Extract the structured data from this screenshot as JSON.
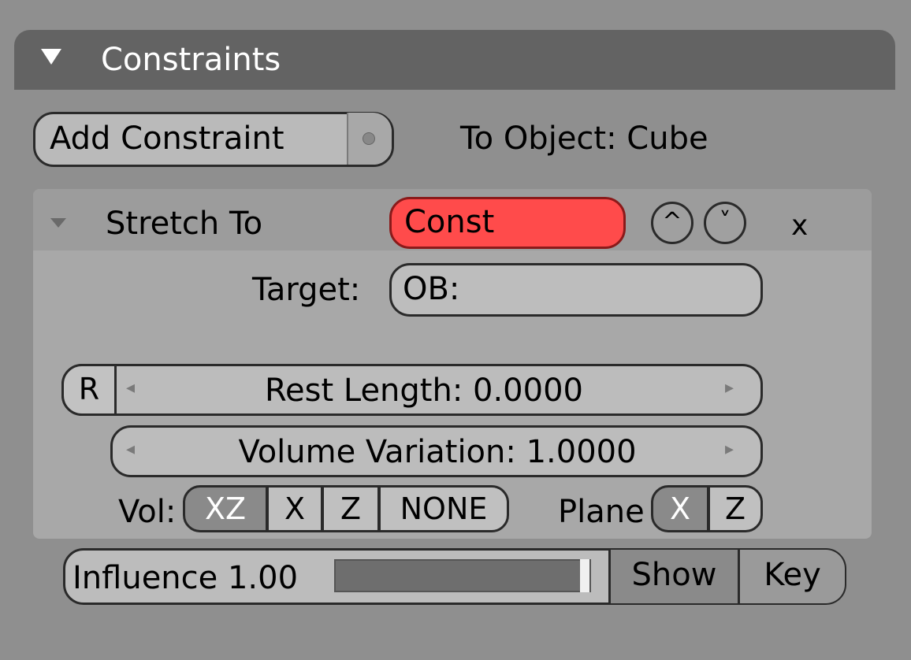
{
  "panel": {
    "title": "Constraints",
    "add_constraint_label": "Add Constraint",
    "to_object_label": "To Object: Cube"
  },
  "constraint": {
    "type_label": "Stretch To",
    "name_value": "Const",
    "name_color": "#ff4b4b",
    "move_up_icon": "chevron-up-icon",
    "move_down_icon": "chevron-down-icon",
    "delete_label": "x",
    "target_label": "Target:",
    "target_value": "OB:",
    "r_button_label": "R",
    "rest_length_label": "Rest Length: 0.0000",
    "volume_variation_label": "Volume Variation: 1.0000",
    "vol_label": "Vol:",
    "vol_options": [
      "XZ",
      "X",
      "Z",
      "NONE"
    ],
    "vol_selected": "XZ",
    "plane_label": "Plane",
    "plane_options": [
      "X",
      "Z"
    ],
    "plane_selected": "X"
  },
  "influence": {
    "label": "Influence 1.00",
    "value": 1.0,
    "show_label": "Show",
    "key_label": "Key"
  }
}
